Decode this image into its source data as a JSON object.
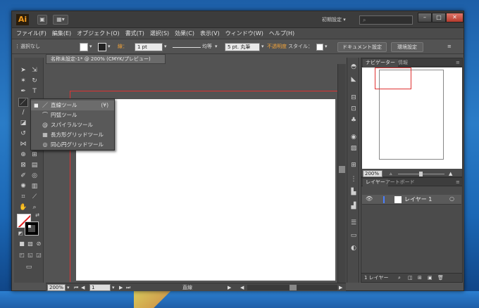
{
  "titlebar": {
    "app_logo": "Ai",
    "workspace": "初期設定 ▾",
    "search_placeholder": "",
    "minimize": "–",
    "maximize": "□",
    "close": "✕"
  },
  "menu": [
    "ファイル(F)",
    "編集(E)",
    "オブジェクト(O)",
    "書式(T)",
    "選択(S)",
    "効果(C)",
    "表示(V)",
    "ウィンドウ(W)",
    "ヘルプ(H)"
  ],
  "control": {
    "selection": "選択なし",
    "stroke_label": "線：",
    "stroke_weight": "1 pt",
    "profile": "均等",
    "brush": "5 pt. 丸筆",
    "opacity_label": "不透明度",
    "style_label": "スタイル：",
    "doc_setup": "ドキュメント設定",
    "prefs": "環境設定"
  },
  "document": {
    "tab_title": "名称未設定-1* @ 200% (CMYK/プレビュー)",
    "tab_close": "×"
  },
  "flyout": {
    "items": [
      {
        "label": "直線ツール",
        "shortcut": "(¥)",
        "icon": "line-segment-icon",
        "glyph": "／",
        "selected": true
      },
      {
        "label": "円弧ツール",
        "shortcut": "",
        "icon": "arc-icon",
        "glyph": "⌒",
        "selected": false
      },
      {
        "label": "スパイラルツール",
        "shortcut": "",
        "icon": "spiral-icon",
        "glyph": "@",
        "selected": false
      },
      {
        "label": "長方形グリッドツール",
        "shortcut": "",
        "icon": "rect-grid-icon",
        "glyph": "▦",
        "selected": false
      },
      {
        "label": "同心円グリッドツール",
        "shortcut": "",
        "icon": "polar-grid-icon",
        "glyph": "◎",
        "selected": false
      }
    ]
  },
  "status": {
    "zoom": "200%",
    "page": "1",
    "tool": "直線"
  },
  "navigator": {
    "tabs": [
      "ナビゲーター",
      "情報"
    ],
    "zoom": "200%"
  },
  "layers": {
    "tabs": [
      "レイヤー",
      "アートボード"
    ],
    "layer_name": "レイヤー 1",
    "footer": "1 レイヤー"
  },
  "colors": {
    "accent": "#f39c1f",
    "bleed": "#dd3333"
  }
}
